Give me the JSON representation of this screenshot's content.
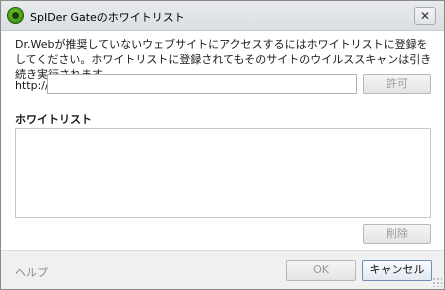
{
  "window": {
    "title": "SpIDer Gateのホワイトリスト",
    "close_label": "✕"
  },
  "description": "Dr.Webが推奨していないウェブサイトにアクセスするにはホワイトリストに登録をしてください。ホワイトリストに登録されてもそのサイトのウイルススキャンは引き続き実行されます。",
  "url_entry": {
    "label": "http://",
    "value": "",
    "allow_label": "許可"
  },
  "whitelist": {
    "heading": "ホワイトリスト",
    "items": [],
    "delete_label": "削除"
  },
  "footer": {
    "help_label": "ヘルプ",
    "ok_label": "OK",
    "cancel_label": "キャンセル"
  },
  "colors": {
    "app_icon": "#3a9a18",
    "disabled_text": "#9a9a9a",
    "footer_bg": "#f0f0f0"
  }
}
